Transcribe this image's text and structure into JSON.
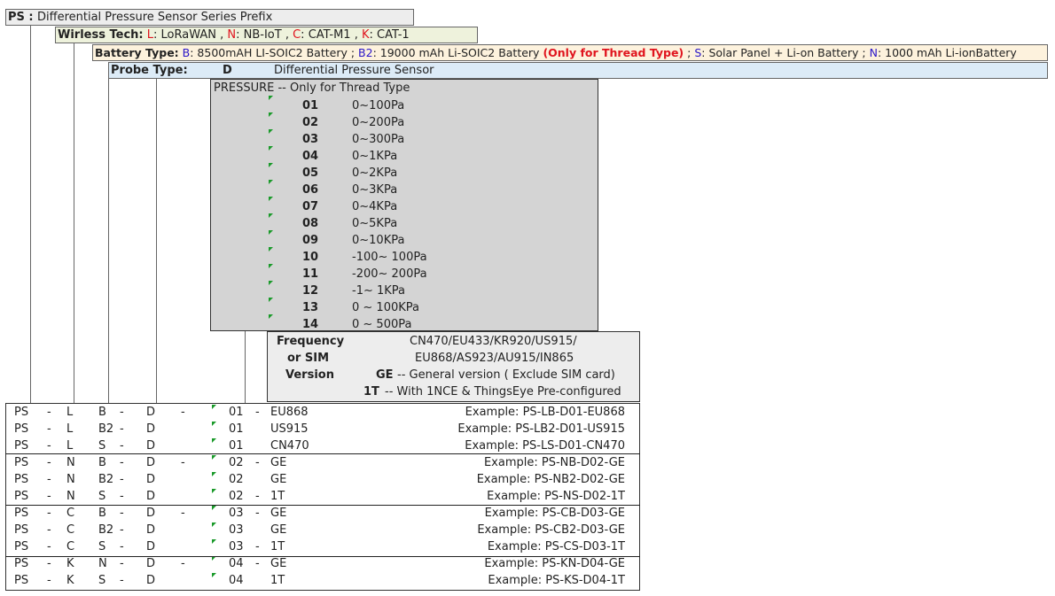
{
  "prefix": {
    "code": "PS :",
    "desc": "Differential Pressure Sensor Series Prefix"
  },
  "wireless": {
    "label": "Wirless Tech:",
    "options": [
      {
        "code": "L",
        "name": "LoRaWAN"
      },
      {
        "code": "N",
        "name": "NB-IoT"
      },
      {
        "code": "C",
        "name": "CAT-M1"
      },
      {
        "code": "K",
        "name": "CAT-1"
      }
    ],
    "sep": " , "
  },
  "battery": {
    "label": "Battery Type:",
    "b_code": "B",
    "b_desc": "8500mAH LI-SOIC2 Battery ;",
    "b2_code": "B2",
    "b2_desc": "19000 mAh Li-SOIC2 Battery",
    "b2_note": "(Only for Thread Type)",
    "sep": ";",
    "s_code": "S",
    "s_desc": "Solar Panel + Li-on Battery ;",
    "n_code": "N",
    "n_desc": "1000 mAh Li-ionBattery"
  },
  "probe": {
    "label": "Probe Type:",
    "code": "D",
    "desc": "Differential Pressure Sensor"
  },
  "pressure": {
    "title": "PRESSURE -- Only for Thread Type",
    "ranges": [
      {
        "code": "01",
        "range": "0~100Pa"
      },
      {
        "code": "02",
        "range": "0~200Pa"
      },
      {
        "code": "03",
        "range": "0~300Pa"
      },
      {
        "code": "04",
        "range": "0~1KPa"
      },
      {
        "code": "05",
        "range": "0~2KPa"
      },
      {
        "code": "06",
        "range": "0~3KPa"
      },
      {
        "code": "07",
        "range": "0~4KPa"
      },
      {
        "code": "08",
        "range": "0~5KPa"
      },
      {
        "code": "09",
        "range": "0~10KPa"
      },
      {
        "code": "10",
        "range": "-100~ 100Pa"
      },
      {
        "code": "11",
        "range": "-200~ 200Pa"
      },
      {
        "code": "12",
        "range": "-1~ 1KPa"
      },
      {
        "code": "13",
        "range": "0 ~ 100KPa"
      },
      {
        "code": "14",
        "range": "0 ~ 500Pa"
      }
    ]
  },
  "frequency": {
    "label1": "Frequency",
    "label2": "or  SIM",
    "label3": "Version",
    "bands1": "CN470/EU433/KR920/US915/",
    "bands2": "EU868/AS923/AU915/IN865",
    "ge_code": "GE",
    "ge_desc": "-- General version ( Exclude SIM card)",
    "t_code": "1T",
    "t_desc": "-- With 1NCE & ThingsEye Pre-configured"
  },
  "examples": [
    {
      "ps": "PS",
      "w": "L",
      "b": "B",
      "d": "D",
      "dash3": "-",
      "p": "01",
      "dash4": "-",
      "f": "EU868",
      "ex": "Example: PS-LB-D01-EU868"
    },
    {
      "ps": "PS",
      "w": "L",
      "b": "B2",
      "d": "D",
      "dash3": "",
      "p": "01",
      "dash4": "",
      "f": "US915",
      "ex": "Example: PS-LB2-D01-US915"
    },
    {
      "ps": "PS",
      "w": "L",
      "b": "S",
      "d": "D",
      "dash3": "",
      "p": "01",
      "dash4": "",
      "f": "CN470",
      "ex": "Example: PS-LS-D01-CN470"
    },
    {
      "ps": "PS",
      "w": "N",
      "b": "B",
      "d": "D",
      "dash3": "-",
      "p": "02",
      "dash4": "-",
      "f": "GE",
      "ex": "Example: PS-NB-D02-GE"
    },
    {
      "ps": "PS",
      "w": "N",
      "b": "B2",
      "d": "D",
      "dash3": "",
      "p": "02",
      "dash4": "",
      "f": "GE",
      "ex": "Example: PS-NB2-D02-GE"
    },
    {
      "ps": "PS",
      "w": "N",
      "b": "S",
      "d": "D",
      "dash3": "",
      "p": "02",
      "dash4": "-",
      "f": "1T",
      "ex": "Example: PS-NS-D02-1T"
    },
    {
      "ps": "PS",
      "w": "C",
      "b": "B",
      "d": "D",
      "dash3": "-",
      "p": "03",
      "dash4": "-",
      "f": "GE",
      "ex": "Example: PS-CB-D03-GE"
    },
    {
      "ps": "PS",
      "w": "C",
      "b": "B2",
      "d": "D",
      "dash3": "",
      "p": "03",
      "dash4": "",
      "f": "GE",
      "ex": "Example: PS-CB2-D03-GE"
    },
    {
      "ps": "PS",
      "w": "C",
      "b": "S",
      "d": "D",
      "dash3": "",
      "p": "03",
      "dash4": "-",
      "f": "1T",
      "ex": "Example: PS-CS-D03-1T"
    },
    {
      "ps": "PS",
      "w": "K",
      "b": "N",
      "d": "D",
      "dash3": "-",
      "p": "04",
      "dash4": "-",
      "f": "GE",
      "ex": "Example: PS-KN-D04-GE"
    },
    {
      "ps": "PS",
      "w": "K",
      "b": "S",
      "d": "D",
      "dash3": "",
      "p": "04",
      "dash4": "",
      "f": "1T",
      "ex": "Example: PS-KS-D04-1T"
    }
  ],
  "sep_dash": "-",
  "colors": {
    "blue": "#2a16c8",
    "red": "#e0141e",
    "green_marker": "#1a9a2a",
    "gray_box": "#d4d4d4",
    "light_gray": "#ededed",
    "wireless_bg": "#eef2dc",
    "battery_bg": "#fdf2dd",
    "probe_bg": "#dcebf7"
  }
}
